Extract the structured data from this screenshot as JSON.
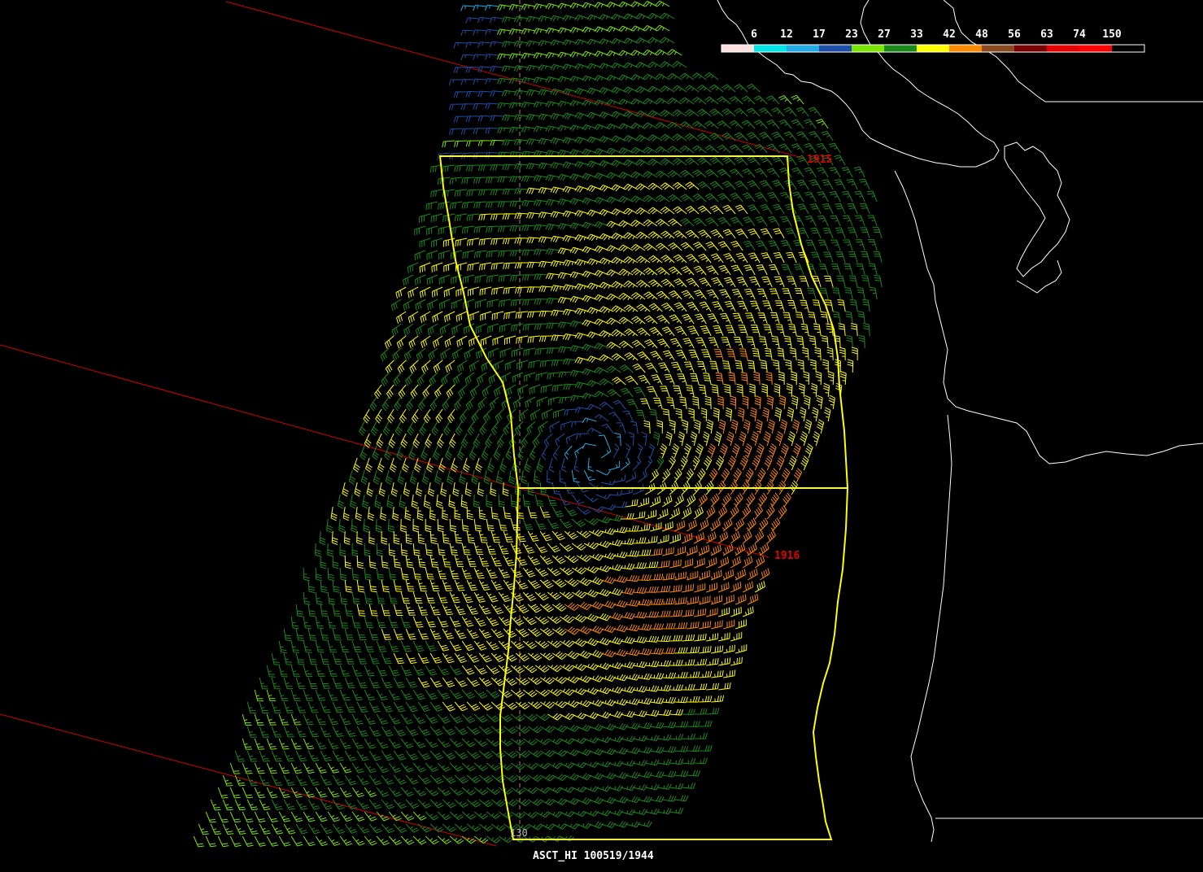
{
  "product_label": "ASCT_HI 100519/1944",
  "longitude_label": "130",
  "swath_time_labels": [
    "1915",
    "1916"
  ],
  "legend": {
    "thresholds": [
      "6",
      "12",
      "17",
      "23",
      "27",
      "33",
      "42",
      "48",
      "56",
      "63",
      "74",
      "150"
    ],
    "colors": [
      "#ffe0e0",
      "#00e6e6",
      "#22aae6",
      "#1f4ea8",
      "#7de600",
      "#1a8a1a",
      "#ffff00",
      "#ff8a00",
      "#8a4a22",
      "#7a0000",
      "#e60000",
      "#ff0000",
      "#000000"
    ]
  },
  "colors": {
    "background": "#000000",
    "coastline": "#ffffff",
    "box_outline": "#ffff00",
    "orbit_track": "#d00000",
    "meridian": "#b38080"
  },
  "wind_field": {
    "center_lat": 47.2,
    "center_lon": -129.2,
    "max_wind_kt": 48,
    "rotation": "cyclonic"
  }
}
